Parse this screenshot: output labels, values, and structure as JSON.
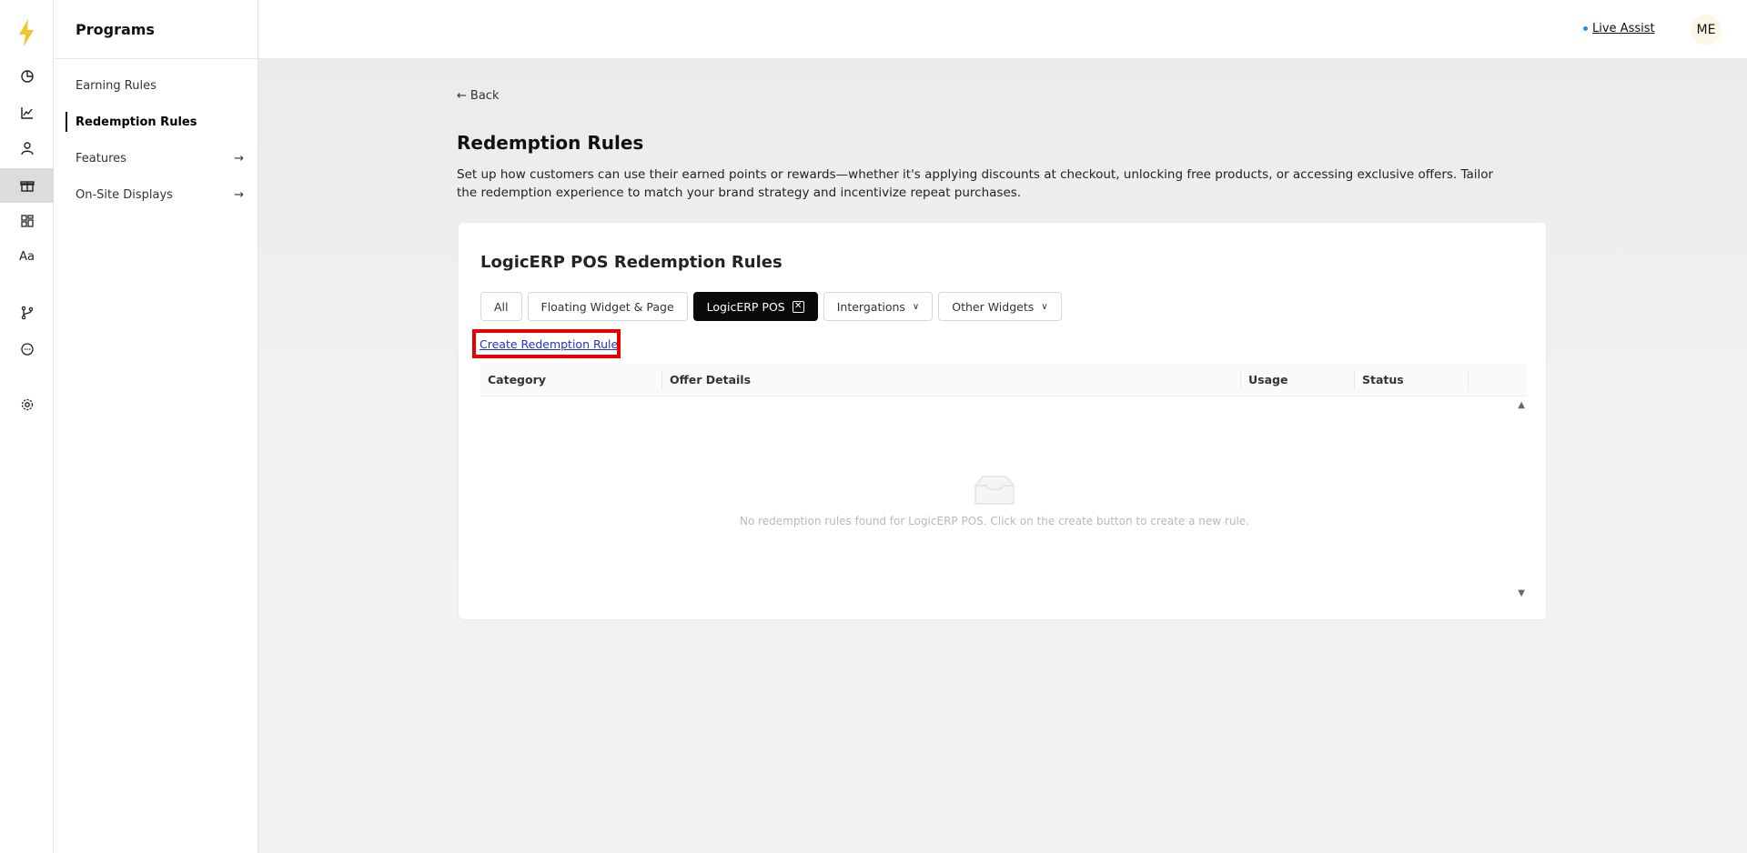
{
  "rail": {
    "icons": [
      "logo-bolt-icon",
      "dashboard-icon",
      "analytics-icon",
      "customers-icon",
      "programs-gift-icon",
      "widgets-icon",
      "typography-icon",
      "branch-icon",
      "chat-icon",
      "settings-icon"
    ],
    "typography_label": "Aa"
  },
  "sidebar": {
    "title": "Programs",
    "items": [
      {
        "label": "Earning Rules",
        "active": false
      },
      {
        "label": "Redemption Rules",
        "active": true
      },
      {
        "label": "Features",
        "active": false
      },
      {
        "label": "On-Site Displays",
        "active": false
      }
    ]
  },
  "topbar": {
    "live_assist": "Live Assist",
    "avatar": "ME"
  },
  "page": {
    "back": "Back",
    "title": "Redemption Rules",
    "description": "Set up how customers can use their earned points or rewards—whether it's applying discounts at checkout, unlocking free products, or accessing exclusive offers. Tailor the redemption experience to match your brand strategy and incentivize repeat purchases."
  },
  "card": {
    "title": "LogicERP POS Redemption Rules",
    "tabs": [
      {
        "label": "All"
      },
      {
        "label": "Floating Widget & Page"
      },
      {
        "label": "LogicERP POS",
        "active": true
      },
      {
        "label": "Intergations"
      },
      {
        "label": "Other Widgets"
      }
    ],
    "create_link": "Create Redemption Rule",
    "table": {
      "columns": [
        "Category",
        "Offer Details",
        "Usage",
        "Status"
      ],
      "empty_text": "No redemption rules found for LogicERP POS. Click on the create button to create a new rule."
    }
  },
  "colors": {
    "accent_bolt": "#f2c230",
    "highlight_box": "#e60000",
    "link": "#1a35d8",
    "active_tab_bg": "#0a0a0a"
  }
}
